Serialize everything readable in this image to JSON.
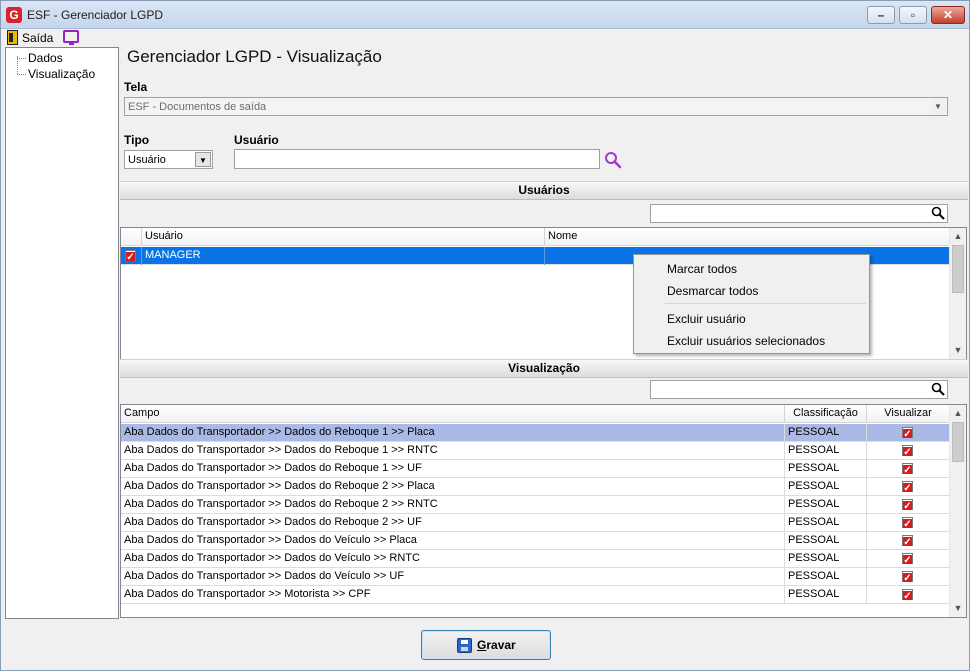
{
  "window": {
    "title": "ESF - Gerenciador LGPD",
    "app_icon_letter": "G"
  },
  "menu": {
    "exit_label": "Saída"
  },
  "tree": {
    "items": [
      "Dados",
      "Visualização"
    ]
  },
  "page": {
    "title": "Gerenciador LGPD - Visualização"
  },
  "form": {
    "tela_label": "Tela",
    "tela_value": "ESF - Documentos de saída",
    "tipo_label": "Tipo",
    "tipo_value": "Usuário",
    "usuario_label": "Usuário",
    "usuario_value": ""
  },
  "users_section": {
    "header": "Usuários",
    "search_value": "",
    "columns": [
      "Usuário",
      "Nome"
    ],
    "rows": [
      {
        "checked": true,
        "usuario": "MANAGER",
        "nome": ""
      }
    ]
  },
  "context_menu": {
    "items": [
      "Marcar todos",
      "Desmarcar todos",
      "Excluir usuário",
      "Excluir usuários selecionados"
    ]
  },
  "visualization_section": {
    "header": "Visualização",
    "search_value": "",
    "columns": [
      "Campo",
      "Classificação",
      "Visualizar"
    ],
    "rows": [
      {
        "campo": "Aba Dados do Transportador >> Dados do Reboque 1 >> Placa",
        "classificacao": "PESSOAL",
        "visualizar": true
      },
      {
        "campo": "Aba Dados do Transportador >> Dados do Reboque 1 >> RNTC",
        "classificacao": "PESSOAL",
        "visualizar": true
      },
      {
        "campo": "Aba Dados do Transportador >> Dados do Reboque 1 >> UF",
        "classificacao": "PESSOAL",
        "visualizar": true
      },
      {
        "campo": "Aba Dados do Transportador >> Dados do Reboque 2 >> Placa",
        "classificacao": "PESSOAL",
        "visualizar": true
      },
      {
        "campo": "Aba Dados do Transportador >> Dados do Reboque 2 >> RNTC",
        "classificacao": "PESSOAL",
        "visualizar": true
      },
      {
        "campo": "Aba Dados do Transportador >> Dados do Reboque 2 >> UF",
        "classificacao": "PESSOAL",
        "visualizar": true
      },
      {
        "campo": "Aba Dados do Transportador >> Dados do Veículo >> Placa",
        "classificacao": "PESSOAL",
        "visualizar": true
      },
      {
        "campo": "Aba Dados do Transportador >> Dados do Veículo >> RNTC",
        "classificacao": "PESSOAL",
        "visualizar": true
      },
      {
        "campo": "Aba Dados do Transportador >> Dados do Veículo >> UF",
        "classificacao": "PESSOAL",
        "visualizar": true
      },
      {
        "campo": "Aba Dados do Transportador >> Motorista >> CPF",
        "classificacao": "PESSOAL",
        "visualizar": true
      }
    ]
  },
  "footer": {
    "save_label_underlined": "G",
    "save_label_rest": "ravar"
  },
  "colors": {
    "selection": "#0a74e6",
    "row_highlight": "#aab9e6",
    "check_red": "#d61c1c",
    "brand_red": "#d8232a",
    "search_icon_purple": "#a13bd0"
  }
}
